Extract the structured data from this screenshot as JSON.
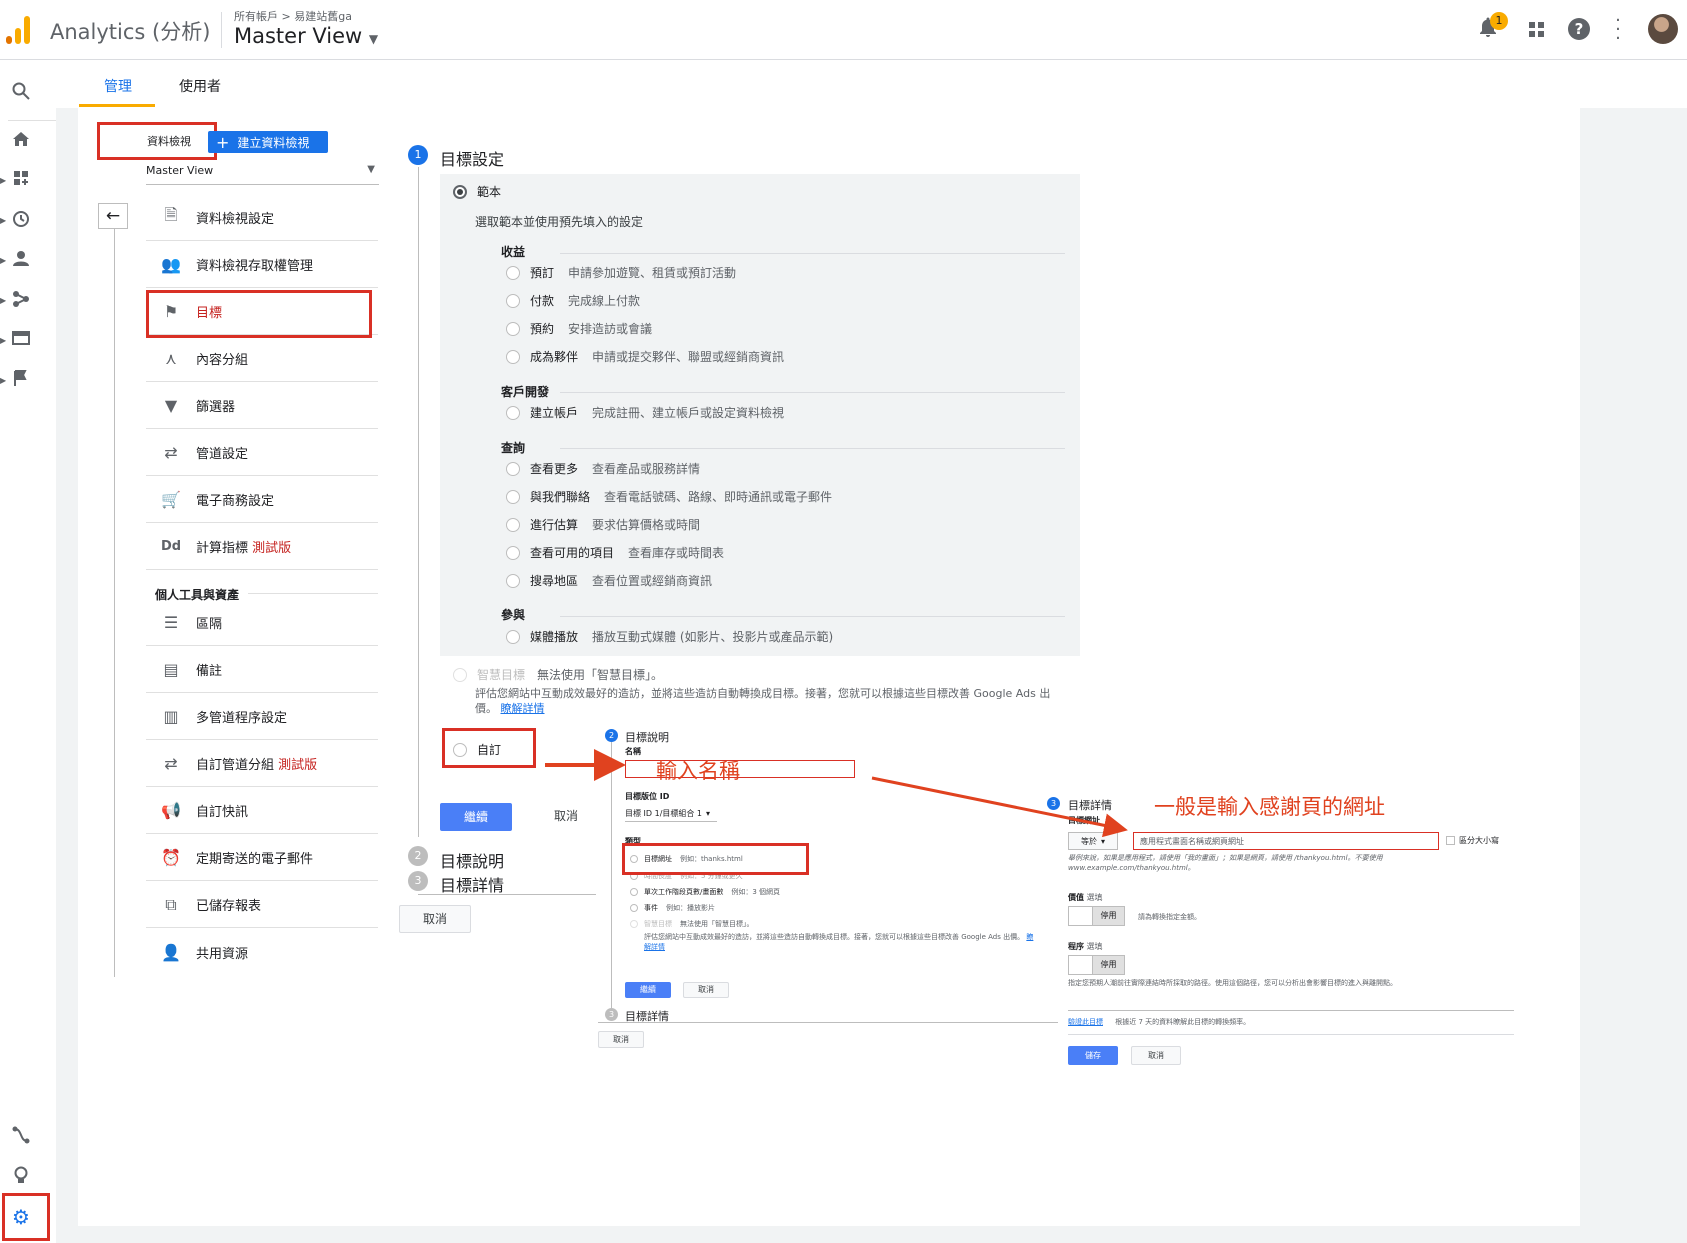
{
  "header": {
    "app_name": "Analytics (分析)",
    "breadcrumb": "所有帳戶 > 易建站舊ga",
    "view_name": "Master View",
    "notification_count": "1"
  },
  "tabs": [
    {
      "label": "管理"
    },
    {
      "label": "使用者"
    }
  ],
  "admin": {
    "view_label": "資料檢視",
    "create_view_label": "建立資料檢視",
    "view_select": "Master View",
    "menu": [
      {
        "label": "資料檢視設定",
        "icon": "document-icon"
      },
      {
        "label": "資料檢視存取權管理",
        "icon": "people-icon"
      },
      {
        "label": "目標",
        "icon": "flag-icon"
      },
      {
        "label": "內容分組",
        "icon": "grouping-icon"
      },
      {
        "label": "篩選器",
        "icon": "filter-icon"
      },
      {
        "label": "管道設定",
        "icon": "channel-icon"
      },
      {
        "label": "電子商務設定",
        "icon": "cart-icon"
      },
      {
        "label": "計算指標",
        "icon": "dd-icon",
        "badge": "測試版"
      }
    ],
    "personal_section": "個人工具與資產",
    "personal_menu": [
      {
        "label": "區隔",
        "icon": "segments-icon"
      },
      {
        "label": "備註",
        "icon": "annotation-icon"
      },
      {
        "label": "多管道程序設定",
        "icon": "bar-chart-icon"
      },
      {
        "label": "自訂管道分組",
        "icon": "channel-icon",
        "badge": "測試版"
      },
      {
        "label": "自訂快訊",
        "icon": "megaphone-icon"
      },
      {
        "label": "定期寄送的電子郵件",
        "icon": "alarm-icon"
      },
      {
        "label": "已儲存報表",
        "icon": "copy-icon"
      },
      {
        "label": "共用資源",
        "icon": "person-add-icon"
      }
    ]
  },
  "goal": {
    "step1_num": "1",
    "step1_title": "目標設定",
    "template_label": "範本",
    "template_desc": "選取範本並使用預先填入的設定",
    "sections": [
      {
        "title": "收益",
        "options": [
          {
            "name": "預訂",
            "desc": "申請參加遊覽、租賃或預訂活動"
          },
          {
            "name": "付款",
            "desc": "完成線上付款"
          },
          {
            "name": "預約",
            "desc": "安排造訪或會議"
          },
          {
            "name": "成為夥伴",
            "desc": "申請或提交夥伴、聯盟或經銷商資訊"
          }
        ]
      },
      {
        "title": "客戶開發",
        "options": [
          {
            "name": "建立帳戶",
            "desc": "完成註冊、建立帳戶或設定資料檢視"
          }
        ]
      },
      {
        "title": "查詢",
        "options": [
          {
            "name": "查看更多",
            "desc": "查看產品或服務詳情"
          },
          {
            "name": "與我們聯絡",
            "desc": "查看電話號碼、路線、即時通訊或電子郵件"
          },
          {
            "name": "進行估算",
            "desc": "要求估算價格或時間"
          },
          {
            "name": "查看可用的項目",
            "desc": "查看庫存或時間表"
          },
          {
            "name": "搜尋地區",
            "desc": "查看位置或經銷商資訊"
          }
        ]
      },
      {
        "title": "參與",
        "options": [
          {
            "name": "媒體播放",
            "desc": "播放互動式媒體 (如影片、投影片或產品示範)"
          }
        ]
      }
    ],
    "smart_label": "智慧目標",
    "smart_status": "無法使用「智慧目標」。",
    "smart_desc": "評估您網站中互動成效最好的造訪，並將這些造訪自動轉換成目標。接著，您就可以根據這些目標改善 Google Ads 出價。",
    "learn_more": "瞭解詳情",
    "custom_label": "自訂",
    "continue_btn": "繼續",
    "cancel_btn": "取消",
    "step2_num": "2",
    "step2_title": "目標說明",
    "step3_num": "3",
    "step3_title": "目標詳情",
    "bottom_cancel": "取消"
  },
  "inset1": {
    "step_num": "2",
    "title": "目標說明",
    "name_label": "名稱",
    "slot_label": "目標版位 ID",
    "slot_value": "目標 ID 1/目標組合 1",
    "type_label": "類型",
    "types": [
      {
        "name": "目標網址",
        "example": "例如：thanks.html"
      },
      {
        "name": "時間長度",
        "example": "例如：5 分鐘或更久"
      },
      {
        "name": "單次工作階段頁數/畫面數",
        "example": "例如：3 個網頁"
      },
      {
        "name": "事件",
        "example": "例如：播放影片"
      },
      {
        "name": "智慧目標",
        "example": "無法使用「智慧目標」。"
      }
    ],
    "smart_desc": "評估您網站中互動成效最好的造訪，並將這些造訪自動轉換成目標。接著，您就可以根據這些目標改善 Google Ads 出價。",
    "learn_more": "瞭解詳情",
    "continue_btn": "繼續",
    "cancel_btn": "取消",
    "step3_num": "3",
    "step3_title": "目標詳情",
    "bottom_cancel": "取消"
  },
  "inset2": {
    "step_num": "3",
    "title": "目標詳情",
    "dest_label": "目標網址",
    "match_value": "等於",
    "url_placeholder": "應用程式畫面名稱或網頁網址",
    "case_label": "區分大小寫",
    "example_text": "舉例來說，如果是應用程式，請使用「我的畫面」；如果是網頁，請使用 /thankyou.html。不要使用 www.example.com/thankyou.html。",
    "value_label": "價值",
    "optional": "選填",
    "toggle_off": "停用",
    "value_hint": "請為轉換指定金額。",
    "funnel_label": "程序",
    "funnel_hint": "指定您預期人潮前往實際連結時所採取的路徑。使用這個路徑，您可以分析出會影響目標的進入與離開點。",
    "verify_link": "驗證此目標",
    "verify_desc": "根據近 7 天的資料瞭解此目標的轉換頻率。",
    "save_btn": "儲存",
    "cancel_btn": "取消"
  },
  "annotations": {
    "name_hint": "輸入名稱",
    "url_hint": "一般是輸入感謝頁的網址"
  },
  "colors": {
    "accent_blue": "#1a73e8",
    "annotation_red": "#d93025",
    "logo_orange": "#f9ab00",
    "logo_dark": "#e37400"
  }
}
